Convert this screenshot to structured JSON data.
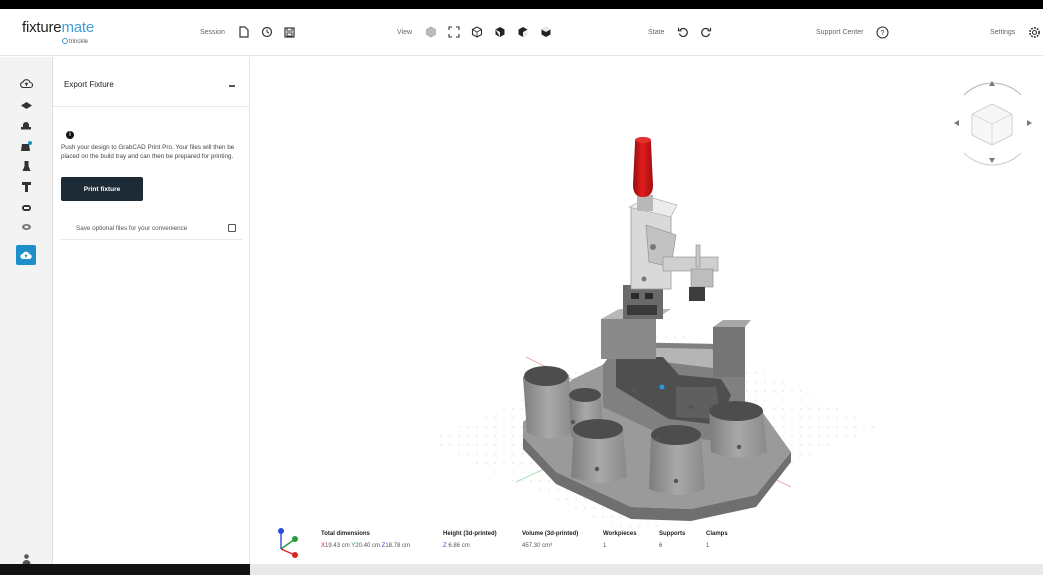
{
  "app": {
    "logo_main": "fixture",
    "logo_accent": "mate",
    "logo_sub": "trinckle"
  },
  "toolbar": {
    "session_label": "Session",
    "view_label": "View",
    "state_label": "State",
    "support_label": "Support Center",
    "settings_label": "Settings"
  },
  "panel": {
    "title": "Export Fixture",
    "info_text": "Push your design to GrabCAD Print Pro. Your files will then be placed on the build tray and can then be prepared for printing.",
    "print_button": "Print fixture",
    "optional_label": "Save optional files for your convenience",
    "optional_checked": false
  },
  "stats": {
    "total_dimensions_label": "Total dimensions",
    "x_axis": "X",
    "x_value": "19.43 cm",
    "y_axis": "Y",
    "y_value": "20.40 cm",
    "z_axis": "Z",
    "z_value": "18.78 cm",
    "height_label": "Height (3d-printed)",
    "height_axis": "Z",
    "height_value": "6.86 cm",
    "volume_label": "Volume (3d-printed)",
    "volume_value": "457.30 cm³",
    "workpieces_label": "Workpieces",
    "workpieces_value": "1",
    "supports_label": "Supports",
    "supports_value": "6",
    "clamps_label": "Clamps",
    "clamps_value": "1"
  },
  "colors": {
    "accent": "#1e90c9",
    "button_dark": "#1d2b36",
    "clamp_handle": "#cc1111"
  }
}
